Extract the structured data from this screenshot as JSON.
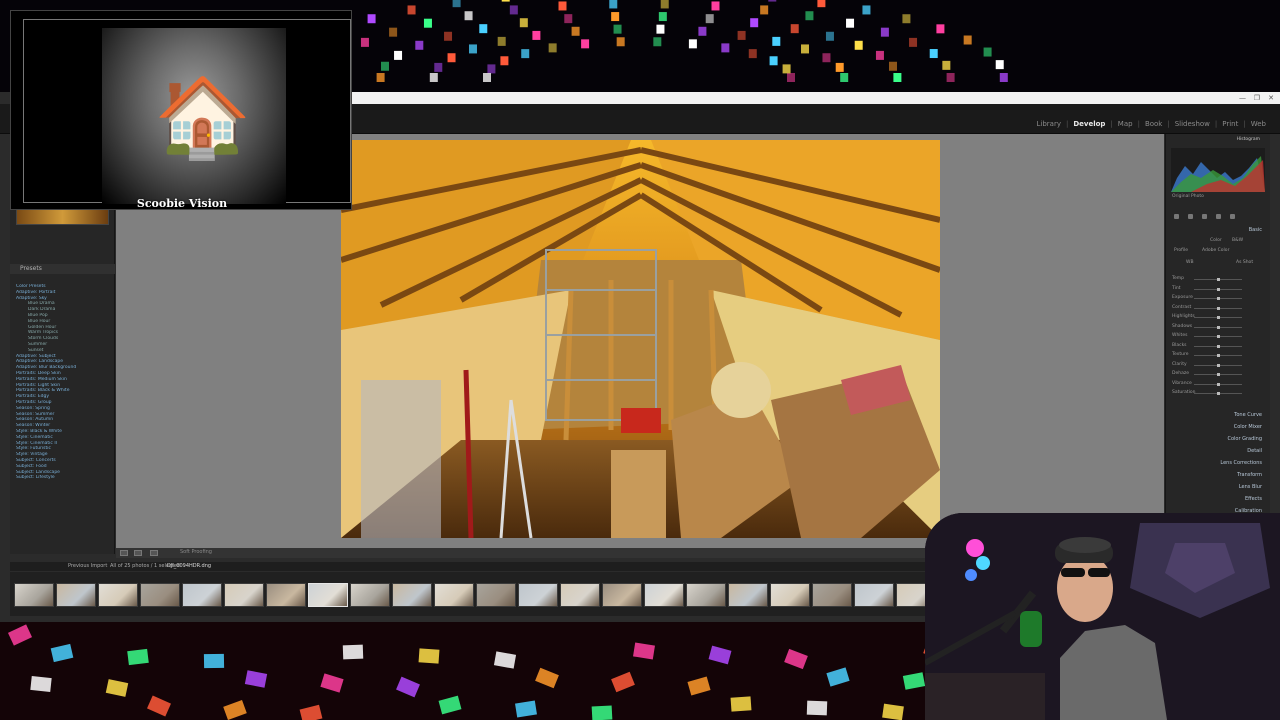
{
  "window": {
    "controls": [
      "—",
      "❐",
      "✕"
    ]
  },
  "topbar": {
    "modules": [
      "Library",
      "Develop",
      "Map",
      "Book",
      "Slideshow",
      "Print",
      "Web"
    ],
    "active_module": "Develop"
  },
  "left_panel": {
    "presets_header": "Presets",
    "presets": [
      {
        "label": "Color Presets",
        "level": "grp"
      },
      {
        "label": "Adaptive: Portrait",
        "level": "grp"
      },
      {
        "label": "Adaptive: Sky",
        "level": "grp"
      },
      {
        "label": "Blue Drama",
        "level": "sub"
      },
      {
        "label": "Dark Drama",
        "level": "sub"
      },
      {
        "label": "Blue Pop",
        "level": "sub"
      },
      {
        "label": "Blue Hour",
        "level": "sub"
      },
      {
        "label": "Golden Hour",
        "level": "sub"
      },
      {
        "label": "Warm Tropics",
        "level": "sub"
      },
      {
        "label": "Storm Clouds",
        "level": "sub"
      },
      {
        "label": "Summer",
        "level": "sub"
      },
      {
        "label": "Sunset",
        "level": "sub"
      },
      {
        "label": "Adaptive: Subject",
        "level": "grp"
      },
      {
        "label": "Adaptive: Landscape",
        "level": "grp"
      },
      {
        "label": "Adaptive: Blur Background",
        "level": "grp"
      },
      {
        "label": "Portraits: Deep Skin",
        "level": "grp"
      },
      {
        "label": "Portraits: Medium Skin",
        "level": "grp"
      },
      {
        "label": "Portraits: Light Skin",
        "level": "grp"
      },
      {
        "label": "Portraits: Black & White",
        "level": "grp"
      },
      {
        "label": "Portraits: Edgy",
        "level": "grp"
      },
      {
        "label": "Portraits: Group",
        "level": "grp"
      },
      {
        "label": "Season: Spring",
        "level": "grp"
      },
      {
        "label": "Season: Summer",
        "level": "grp"
      },
      {
        "label": "Season: Autumn",
        "level": "grp"
      },
      {
        "label": "Season: Winter",
        "level": "grp"
      },
      {
        "label": "Style: Black & White",
        "level": "grp"
      },
      {
        "label": "Style: Cinematic",
        "level": "grp"
      },
      {
        "label": "Style: Cinematic II",
        "level": "grp"
      },
      {
        "label": "Style: Futuristic",
        "level": "grp"
      },
      {
        "label": "Style: Vintage",
        "level": "grp"
      },
      {
        "label": "Subject: Concerts",
        "level": "grp"
      },
      {
        "label": "Subject: Food",
        "level": "grp"
      },
      {
        "label": "Subject: Landscape",
        "level": "grp"
      },
      {
        "label": "Subject: Lifestyle",
        "level": "grp"
      }
    ],
    "copy_button": "Copy...",
    "paste_button": "Paste"
  },
  "toolbar": {
    "soft_proofing": "Soft Proofing"
  },
  "right_panel": {
    "histogram_header": "Histogram",
    "original_photo": "Original Photo",
    "basic_header": "Basic",
    "treatment_options": [
      "Color",
      "B&W"
    ],
    "profile_label": "Profile",
    "profile_value": "Adobe Color",
    "wb_label": "WB",
    "wb_value": "As Shot",
    "sliders": [
      "Temp",
      "Tint",
      "Exposure",
      "Contrast",
      "Highlights",
      "Shadows",
      "Whites",
      "Blacks",
      "Texture",
      "Clarity",
      "Dehaze",
      "Vibrance",
      "Saturation"
    ],
    "sections": [
      "Tone Curve",
      "Color Mixer",
      "Color Grading",
      "Detail",
      "Lens Corrections",
      "Transform",
      "Lens Blur",
      "Effects",
      "Calibration"
    ]
  },
  "filmstrip": {
    "previous_import": "Previous Import",
    "selection_info": "All of 25 photos / 1 selected",
    "filename": "DJI_0094HDR.dng",
    "thumbnail_count": 22
  },
  "webcam_overlay": {
    "label": "Scoobie Vision"
  },
  "colors": {
    "panel_bg": "#262626",
    "canvas_bg": "#808080",
    "topbar_bg": "#1a1a1a",
    "accent_blue": "#7ab0d8"
  }
}
